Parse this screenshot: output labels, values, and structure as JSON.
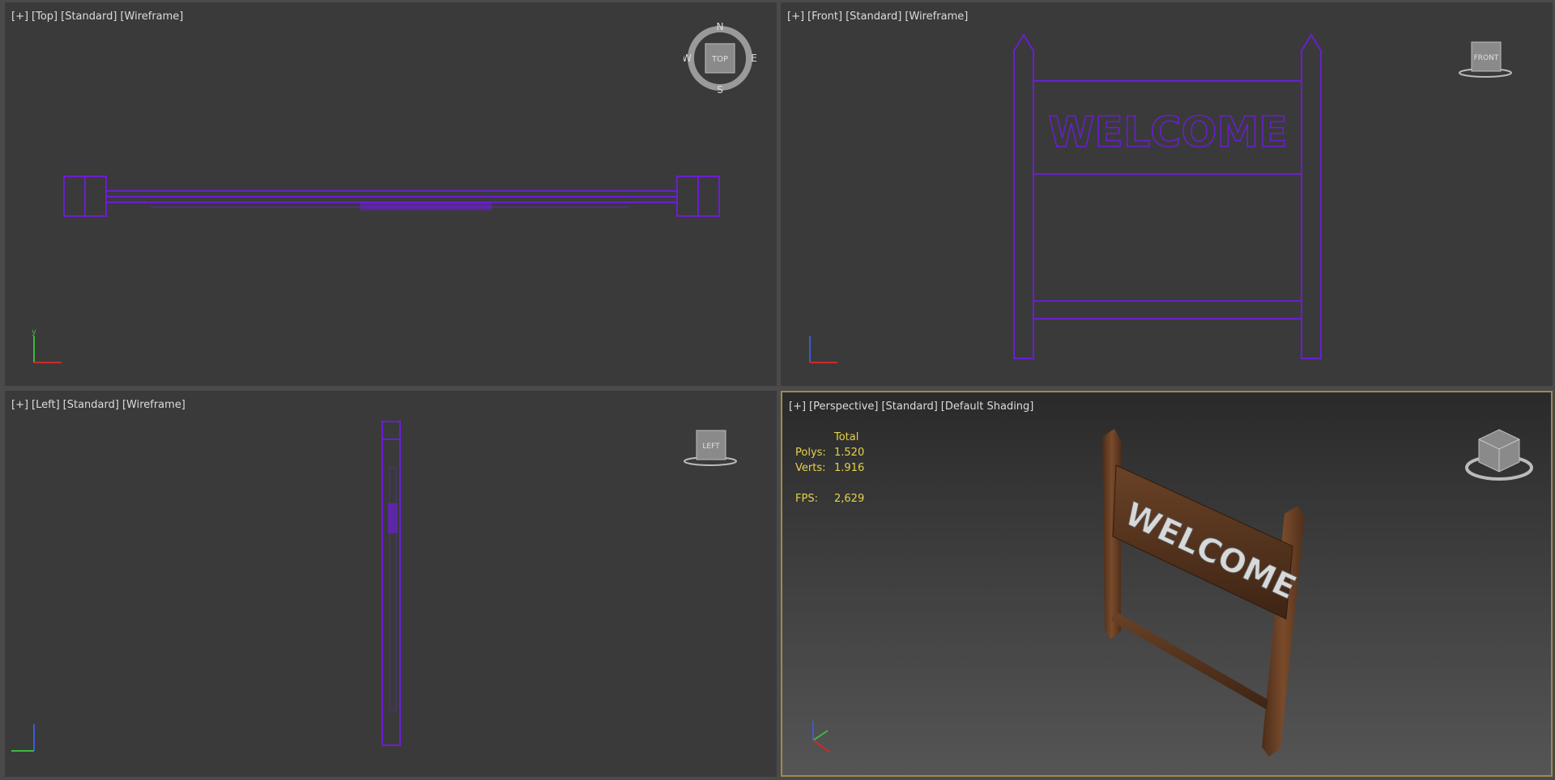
{
  "viewports": {
    "top": {
      "labels": [
        "[+]",
        "[Top]",
        "[Standard]",
        "[Wireframe]"
      ],
      "cube_face": "TOP",
      "compass": {
        "n": "N",
        "s": "S",
        "e": "E",
        "w": "W"
      },
      "axes": {
        "v": "y",
        "h": "x"
      }
    },
    "front": {
      "labels": [
        "[+]",
        "[Front]",
        "[Standard]",
        "[Wireframe]"
      ],
      "cube_face": "FRONT",
      "sign_text": "WELCOME",
      "axes": {
        "v": "z",
        "h": "x"
      }
    },
    "left": {
      "labels": [
        "[+]",
        "[Left]",
        "[Standard]",
        "[Wireframe]"
      ],
      "cube_face": "LEFT",
      "axes": {
        "v": "z",
        "h": "y"
      }
    },
    "perspective": {
      "labels": [
        "[+]",
        "[Perspective]",
        "[Standard]",
        "[Default Shading]"
      ],
      "sign_text": "WELCOME",
      "stats": {
        "header": "Total",
        "polys_label": "Polys:",
        "polys": "1.520",
        "verts_label": "Verts:",
        "verts": "1.916",
        "fps_label": "FPS:",
        "fps": "2,629"
      },
      "axes": {
        "v": "z",
        "h": "y",
        "d": "x"
      }
    }
  },
  "colors": {
    "wire": "#6a1fd0",
    "stats": "#e6d24a",
    "active_border": "#a08a4c",
    "wood": "#6b4226"
  }
}
